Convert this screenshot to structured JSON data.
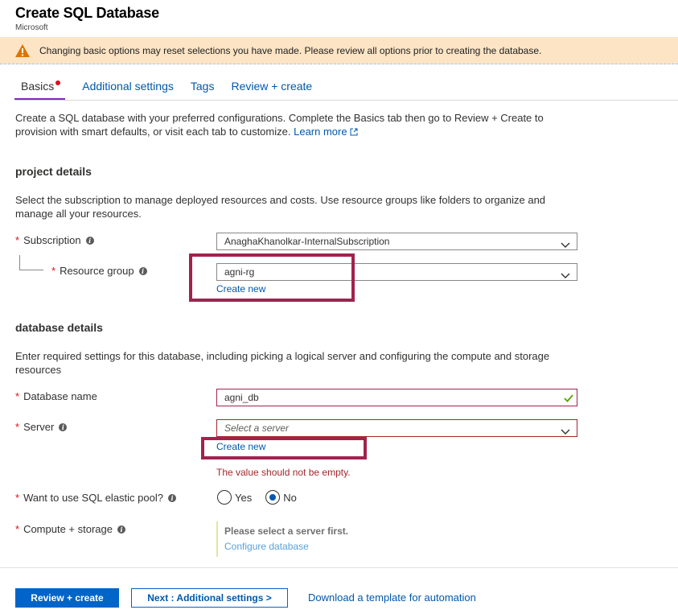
{
  "header": {
    "title": "Create SQL Database",
    "subtitle": "Microsoft"
  },
  "warning": {
    "icon": "warning-icon",
    "text": "Changing basic options may reset selections you have made. Please review all options prior to creating the database."
  },
  "tabs": [
    {
      "label": "Basics",
      "active": true,
      "has_error_dot": true
    },
    {
      "label": "Additional settings",
      "active": false
    },
    {
      "label": "Tags",
      "active": false
    },
    {
      "label": "Review + create",
      "active": false
    }
  ],
  "intro": {
    "text": "Create a SQL database with your preferred configurations. Complete the Basics tab then go to Review + Create to provision with smart defaults, or visit each tab to customize.",
    "learn_more": "Learn more"
  },
  "project_details": {
    "heading": "project details",
    "description": "Select the subscription to manage deployed resources and costs. Use resource groups like folders to organize and manage all your resources.",
    "subscription": {
      "label": "Subscription",
      "value": "AnaghaKhanolkar-InternalSubscription"
    },
    "resource_group": {
      "label": "Resource group",
      "value": "agni-rg",
      "create_new": "Create new"
    }
  },
  "database_details": {
    "heading": "database details",
    "description": "Enter required settings for this database, including picking a logical server and configuring the compute and storage resources",
    "database_name": {
      "label": "Database name",
      "value": "agni_db"
    },
    "server": {
      "label": "Server",
      "placeholder": "Select a server",
      "create_new": "Create new",
      "error": "The value should not be empty."
    },
    "elastic_pool": {
      "label": "Want to use SQL elastic pool?",
      "options": [
        "Yes",
        "No"
      ],
      "selected": "No"
    },
    "compute_storage": {
      "label": "Compute + storage",
      "message": "Please select a server first.",
      "configure_link": "Configure database"
    }
  },
  "footer": {
    "primary_button": "Review + create",
    "next_button": "Next : Additional settings >",
    "template_link": "Download a template for automation"
  },
  "colors": {
    "accent": "#0064c8",
    "link": "#0058ad",
    "error": "#a4262c",
    "required": "#e00b1c",
    "highlight": "#a1224f",
    "warning_bg": "#fce4c4",
    "active_tab_underline": "#7b2bb9",
    "success_check": "#57a300"
  }
}
